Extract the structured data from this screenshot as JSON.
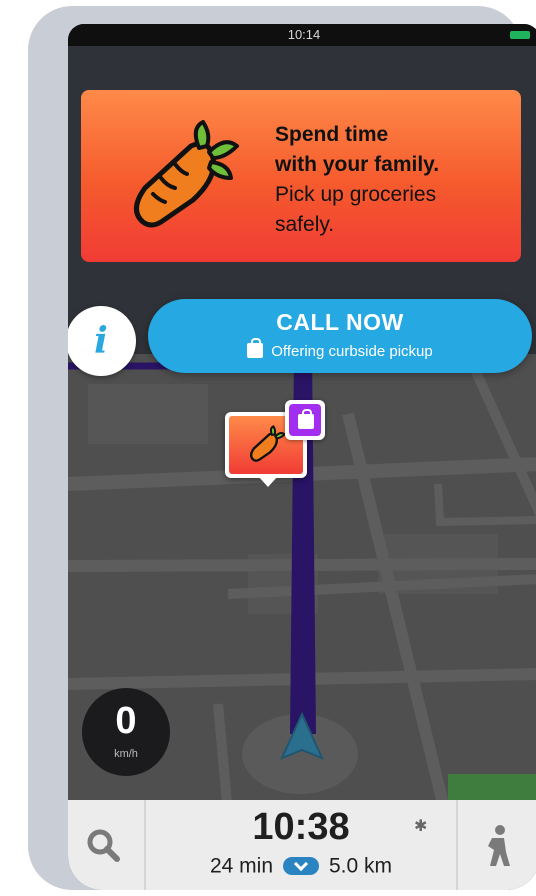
{
  "status_bar": {
    "time": "10:14"
  },
  "promo": {
    "title": "Spend time\nwith your family.",
    "subtitle": "Pick up groceries\nsafely."
  },
  "info_icon": {
    "glyph": "i"
  },
  "call_now": {
    "label": "CALL NOW",
    "subtitle": "Offering curbside pickup"
  },
  "speedometer": {
    "value": "0",
    "unit": "km/h"
  },
  "trip": {
    "eta_time": "10:38",
    "duration": "24 min",
    "distance": "5.0 km"
  },
  "bluetooth_glyph": "✱",
  "colors": {
    "promo_gradient_top": "#ff8a49",
    "promo_gradient_bottom": "#f13c35",
    "call_button": "#26a8e2",
    "route": "#2a1466",
    "navigation_arrow": "#2b6f8f",
    "pin_badge": "#a22ef0"
  },
  "icons": [
    "carrot-icon",
    "info-icon",
    "shopping-bag-icon",
    "search-icon",
    "bluetooth-icon",
    "pedestrian-icon",
    "navigation-arrow-icon"
  ]
}
